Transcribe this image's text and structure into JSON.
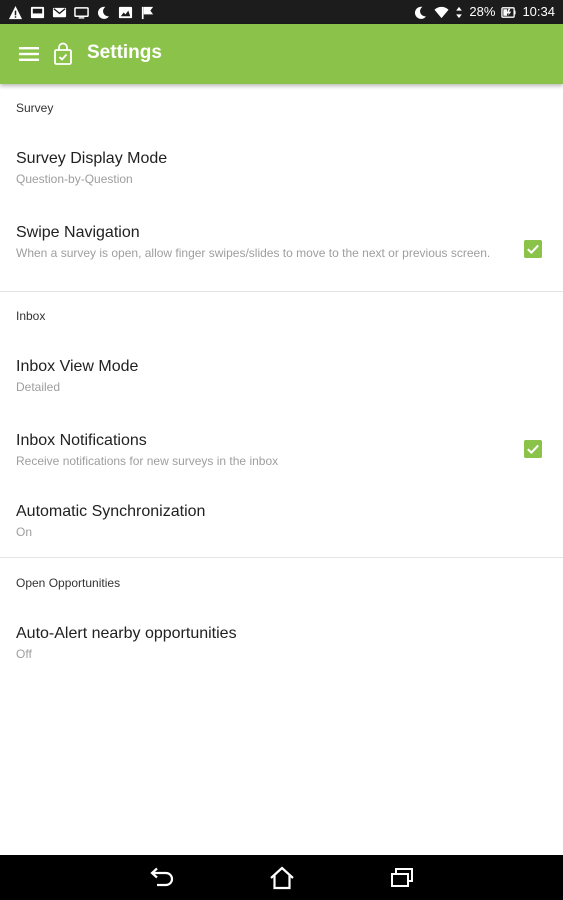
{
  "status_bar": {
    "battery": "28%",
    "time": "10:34",
    "left_icons": [
      "warning-icon",
      "inbox-icon",
      "mail-icon",
      "tv-icon",
      "moon-icon",
      "image-icon",
      "flag-icon"
    ],
    "right_icons": [
      "moon-icon",
      "wifi-icon",
      "data-icon",
      "battery-icon"
    ]
  },
  "app_bar": {
    "title": "Settings",
    "color": "#8bc34a",
    "menu_icon": "hamburger-icon",
    "logo_icon": "shopping-bag-icon"
  },
  "sections": [
    {
      "header": "Survey",
      "items": [
        {
          "title": "Survey Display Mode",
          "summary": "Question-by-Question",
          "checkbox": null
        },
        {
          "title": "Swipe Navigation",
          "summary": "When a survey is open, allow finger swipes/slides to move to the next or previous screen.",
          "checkbox": true
        }
      ]
    },
    {
      "header": "Inbox",
      "items": [
        {
          "title": "Inbox View Mode",
          "summary": "Detailed",
          "checkbox": null
        },
        {
          "title": "Inbox Notifications",
          "summary": "Receive notifications for new surveys in the inbox",
          "checkbox": true
        },
        {
          "title": "Automatic Synchronization",
          "summary": "On",
          "checkbox": null
        }
      ]
    },
    {
      "header": "Open Opportunities",
      "items": [
        {
          "title": "Auto-Alert nearby opportunities",
          "summary": "Off",
          "checkbox": null
        }
      ]
    }
  ],
  "nav_bar": {
    "buttons": [
      "back-icon",
      "home-icon",
      "recents-icon"
    ]
  }
}
